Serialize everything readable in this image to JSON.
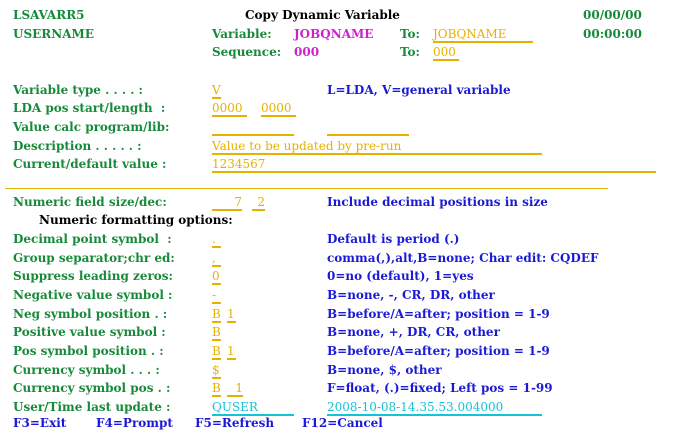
{
  "header": {
    "program": "LSAVARR5",
    "title": "Copy Dynamic Variable",
    "date": "00/00/00",
    "user": "USERNAME",
    "variable_label": "Variable:",
    "variable_value": "JOBQNAME",
    "to_label": "To:",
    "to_variable": "JOBQNAME",
    "time": "00:00:00",
    "sequence_label": "Sequence:",
    "sequence_value": "000",
    "to_sequence": "000"
  },
  "fields": {
    "variable_type": {
      "label": "Variable type . . . . :",
      "value": "V",
      "help": "L=LDA, V=general variable"
    },
    "lda_pos": {
      "label": "LDA pos start/length  :",
      "start": "0000",
      "length": "0000"
    },
    "value_calc": {
      "label": "Value calc program/lib:",
      "program": "",
      "library": ""
    },
    "description": {
      "label": "Description . . . . . :",
      "value": "Value to be updated by pre-run"
    },
    "current_value": {
      "label": "Current/default value :",
      "value": "1234567"
    }
  },
  "numeric": {
    "size": {
      "label": "Numeric field size/dec:",
      "size": "7",
      "decimals": "2",
      "help": "Include decimal positions in size"
    },
    "heading": "Numeric formatting options:",
    "decimal_point": {
      "label": "Decimal point symbol  :",
      "value": ".",
      "help": "Default is period (.)"
    },
    "group_separator": {
      "label": "Group separator;chr ed:",
      "value": ",",
      "help": "comma(,),alt,B=none; Char edit: CQDEF"
    },
    "suppress_zeros": {
      "label": "Suppress leading zeros:",
      "value": "0",
      "help": "0=no (default), 1=yes"
    },
    "negative_symbol": {
      "label": "Negative value symbol :",
      "value": "-",
      "help": "B=none, -, CR, DR, other"
    },
    "neg_position": {
      "label": "Neg symbol position . :",
      "side": "B",
      "position": "1",
      "help": "B=before/A=after; position = 1-9"
    },
    "positive_symbol": {
      "label": "Positive value symbol :",
      "value": "B",
      "help": "B=none, +, DR, CR, other"
    },
    "pos_position": {
      "label": "Pos symbol position . :",
      "side": "B",
      "position": "1",
      "help": "B=before/A=after; position = 1-9"
    },
    "currency_symbol": {
      "label": "Currency symbol . . . :",
      "value": "$",
      "help": "B=none, $, other"
    },
    "currency_pos": {
      "label": "Currency symbol pos . :",
      "side": "B",
      "position": "1",
      "help": "F=float, (.)=fixed; Left pos = 1-99"
    }
  },
  "footer": {
    "last_update_label": "User/Time last update :",
    "last_user": "QUSER",
    "last_time": "2008-10-08-14.35.53.004000"
  },
  "function_keys": [
    "F3=Exit",
    "F4=Prompt",
    "F5=Refresh",
    "F12=Cancel"
  ]
}
